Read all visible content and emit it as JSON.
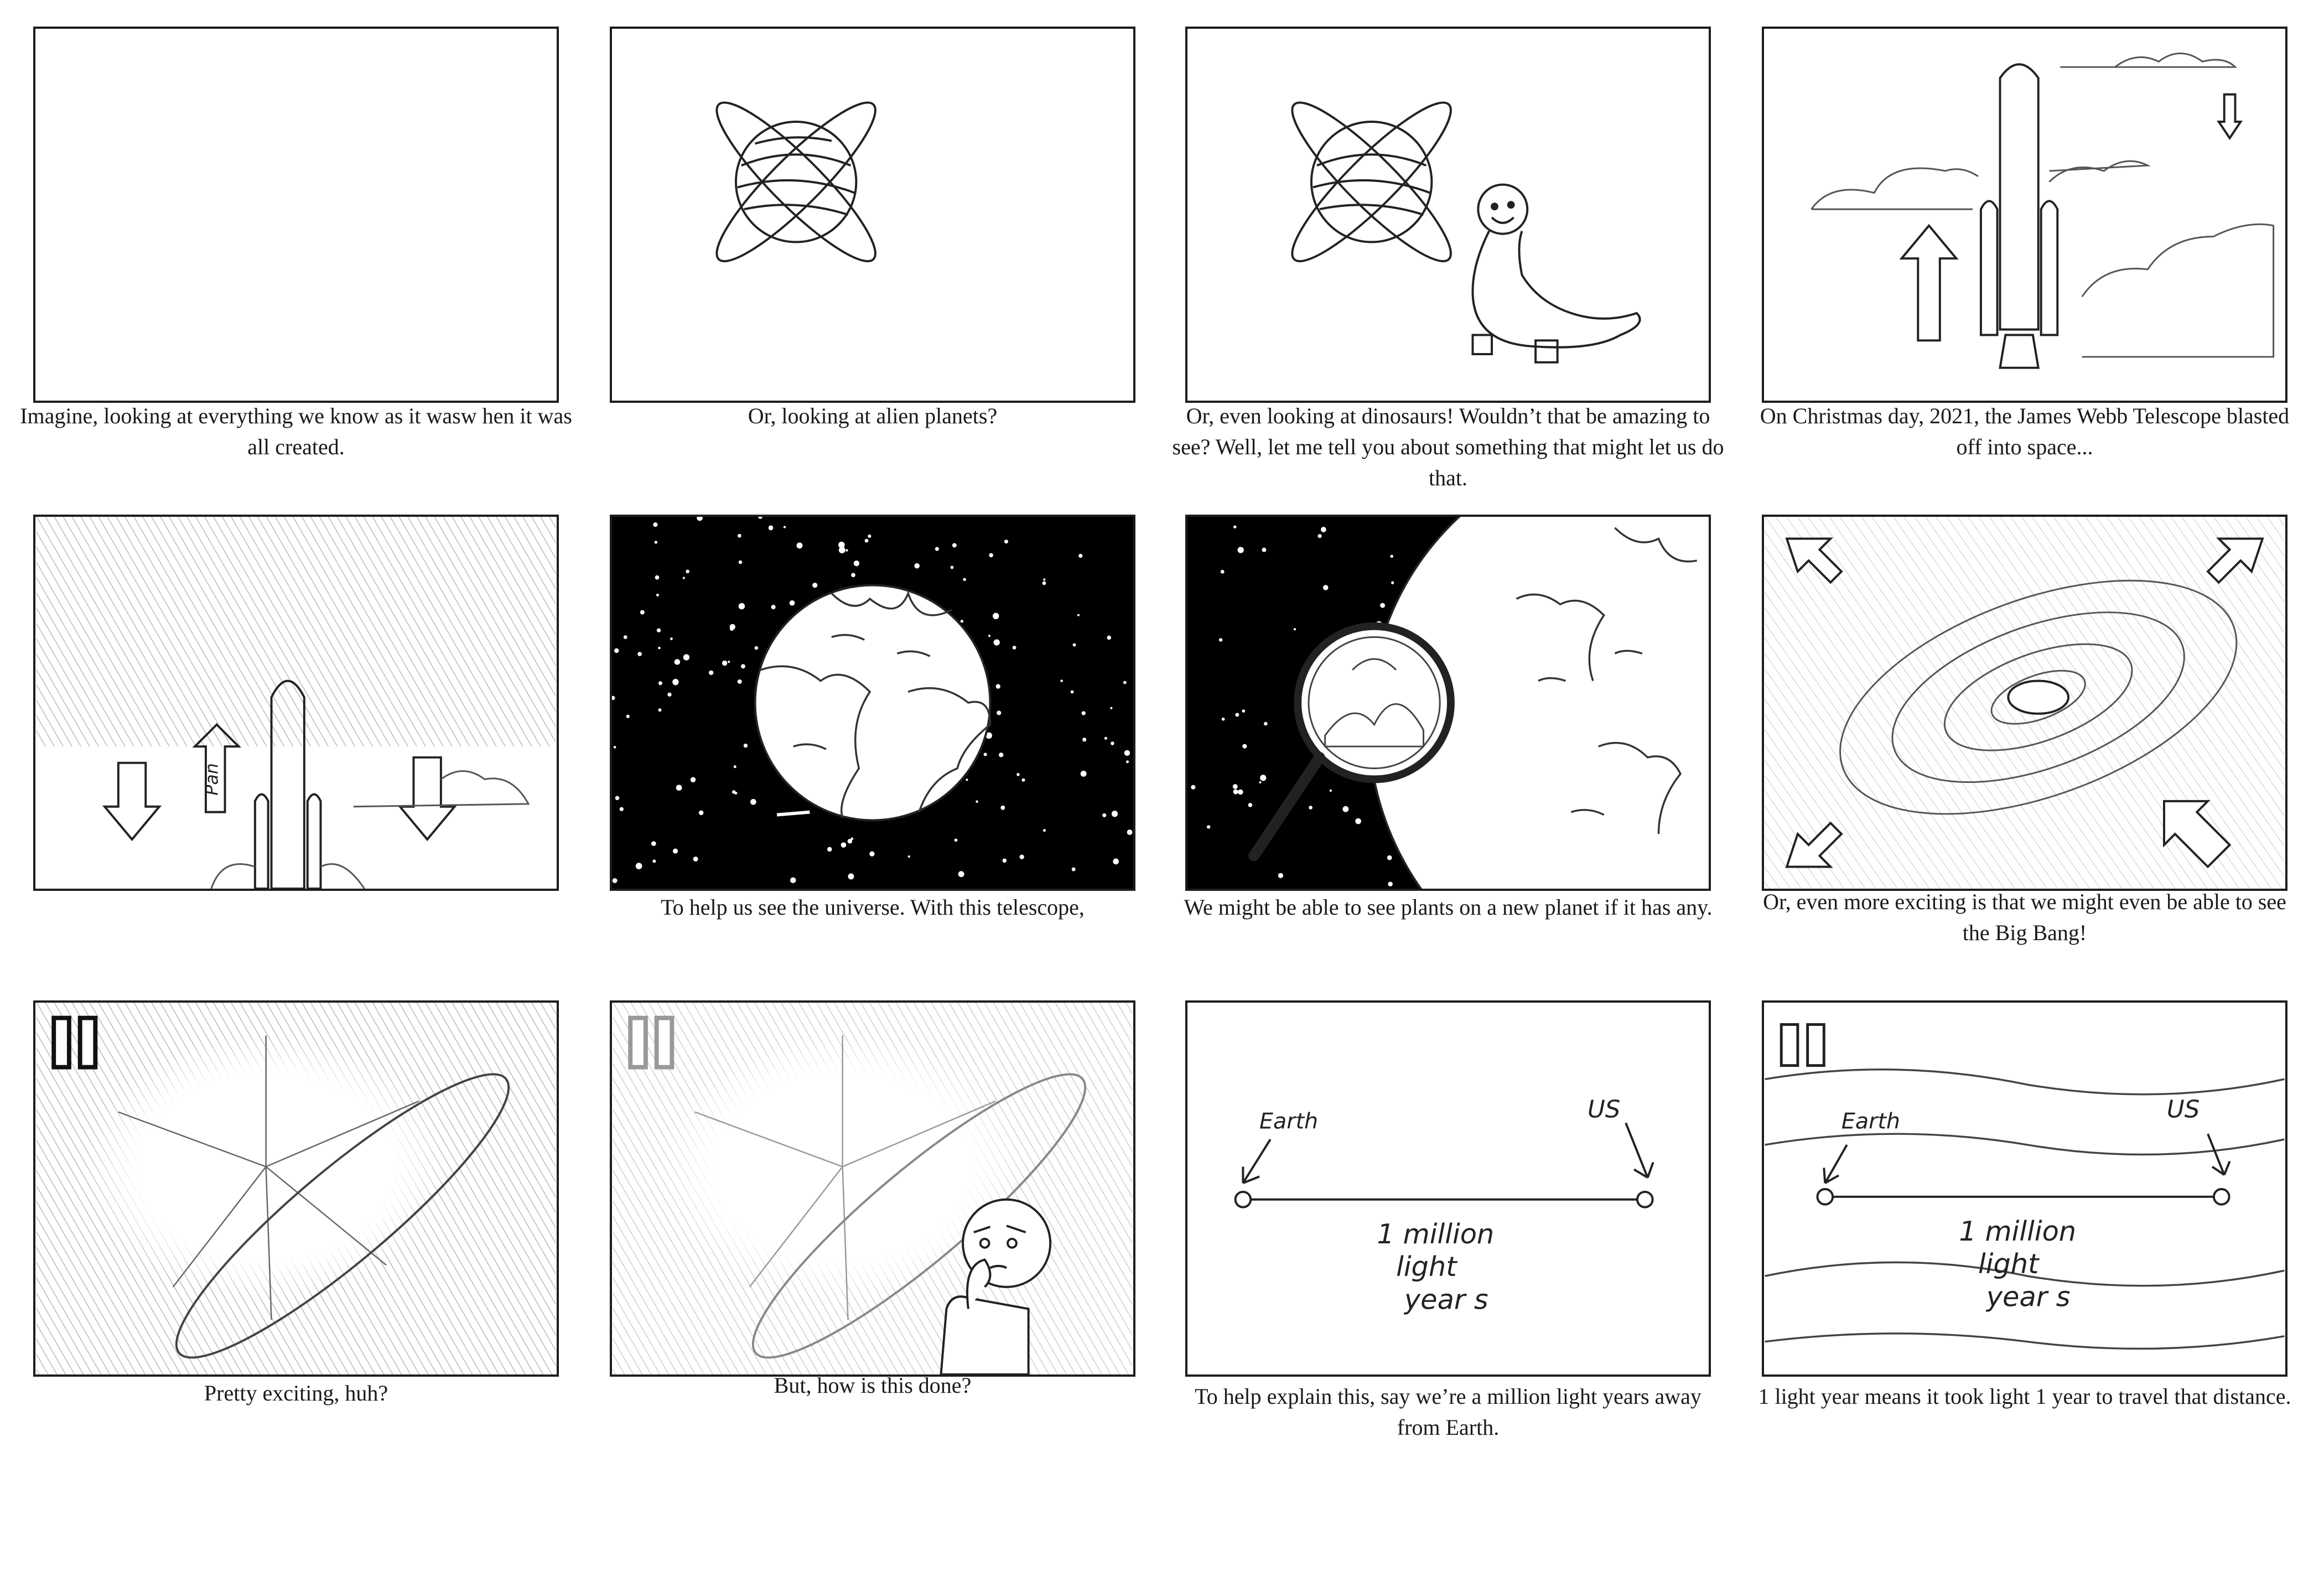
{
  "captions": [
    "Imagine, looking at everything we know as it wasw hen it was all created.",
    "Or, looking at alien planets?",
    "Or, even looking at dinosaurs! Wouldn’t that be amazing to see? Well, let me tell you about something that might let us do that.",
    "On Christmas day, 2021, the James Webb Telescope blasted off into space...",
    "",
    "To help us see the universe. With this telescope,",
    "We might be able to see plants on a new planet if it has any.",
    "Or, even more exciting is that we might even be able to see the Big Bang!",
    "Pretty exciting, huh?",
    "But, how is this done?",
    "To help explain this, say we’re a million light years away from Earth.",
    "1 light year means it took light 1 year to travel that distance."
  ],
  "panel5": {
    "arrow_label": "Pan"
  },
  "diagram": {
    "earth_label": "Earth",
    "us_label": "US",
    "distance_line1": "1 million",
    "distance_line2": "light",
    "distance_line3": "year s"
  }
}
